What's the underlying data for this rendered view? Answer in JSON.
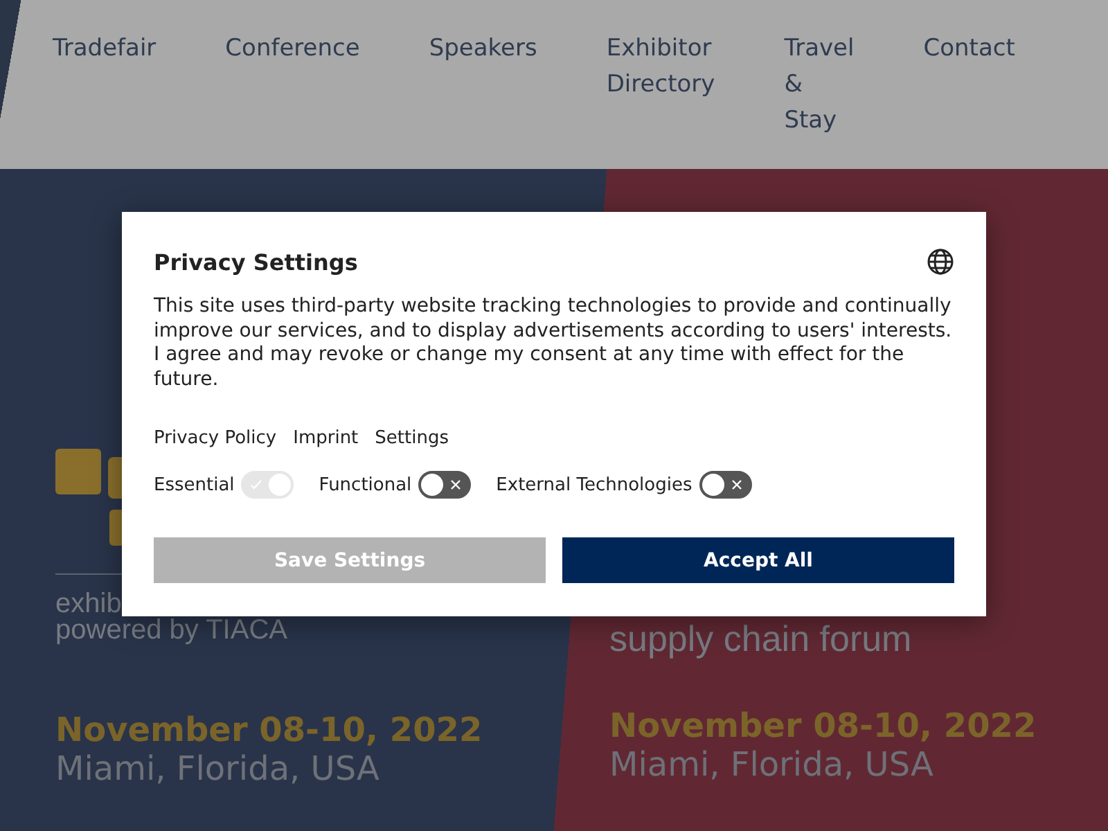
{
  "nav": [
    "Tradefair",
    "Conference",
    "Speakers",
    "Exhibitor Directory",
    "Travel & Stay",
    "Contact"
  ],
  "events": [
    {
      "tagline": [
        "exhib",
        "powered by TIACA"
      ],
      "date": "November 08-10, 2022",
      "location": "Miami, Florida, USA",
      "kind": "logo"
    },
    {
      "tagline": [
        "supply chain forum"
      ],
      "date": "November 08-10, 2022",
      "location": "Miami, Florida, USA",
      "kind": "plain"
    }
  ],
  "dialog": {
    "title": "Privacy Settings",
    "text": "This site uses third-party website tracking technologies to provide and continually improve our services, and to display advertisements according to users' interests. I agree and may revoke or change my consent at any time with effect for the future.",
    "links": [
      "Privacy Policy",
      "Imprint",
      "Settings"
    ],
    "toggles": [
      {
        "label": "Essential",
        "checked": true
      },
      {
        "label": "Functional",
        "checked": false
      },
      {
        "label": "External Technologies",
        "checked": false
      }
    ],
    "buttons": [
      {
        "label": "Save Settings",
        "kind": "secondary"
      },
      {
        "label": "Accept All",
        "kind": "primary"
      }
    ]
  }
}
